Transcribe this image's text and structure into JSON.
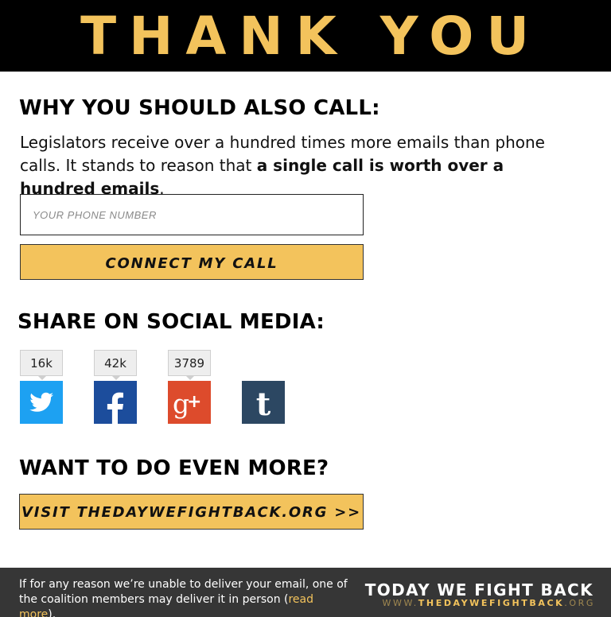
{
  "header": {
    "title": "THANK YOU"
  },
  "call_section": {
    "heading": "WHY YOU SHOULD ALSO CALL:",
    "intro_text": "Legislators receive over a hundred times more emails than phone calls. It stands to reason that ",
    "intro_bold": "a single call is worth over a hundred emails",
    "intro_end": ".",
    "phone_placeholder": "YOUR PHONE NUMBER",
    "phone_value": "",
    "connect_label": "CONNECT MY CALL"
  },
  "share_section": {
    "heading": "SHARE ON SOCIAL MEDIA:",
    "networks": [
      {
        "name": "twitter",
        "count": "16k",
        "color": "#1da1f2",
        "icon": "twitter-bird-icon"
      },
      {
        "name": "facebook",
        "count": "42k",
        "color": "#1c4d9c",
        "icon": "facebook-f-icon"
      },
      {
        "name": "google-plus",
        "count": "3789",
        "color": "#dd4b2c",
        "icon": "google-plus-icon"
      },
      {
        "name": "tumblr",
        "count": "",
        "color": "#2c4762",
        "icon": "tumblr-t-icon"
      }
    ]
  },
  "more_section": {
    "heading": "WANT TO DO EVEN MORE?",
    "visit_label": "VISIT THEDAYWEFIGHTBACK.ORG >>"
  },
  "footer": {
    "note_text": "If for any reason we’re unable to deliver your email, one of the coalition members may deliver it in person (",
    "read_more": "read more",
    "note_end": ").",
    "brand_title": "TODAY WE FIGHT BACK",
    "brand_url_prefix": "WWW.",
    "brand_url_main": "THEDAYWEFIGHTBACK",
    "brand_url_suffix": ".ORG"
  },
  "colors": {
    "accent": "#f3c35c",
    "header_bg": "#000000",
    "footer_bg": "#363636"
  }
}
